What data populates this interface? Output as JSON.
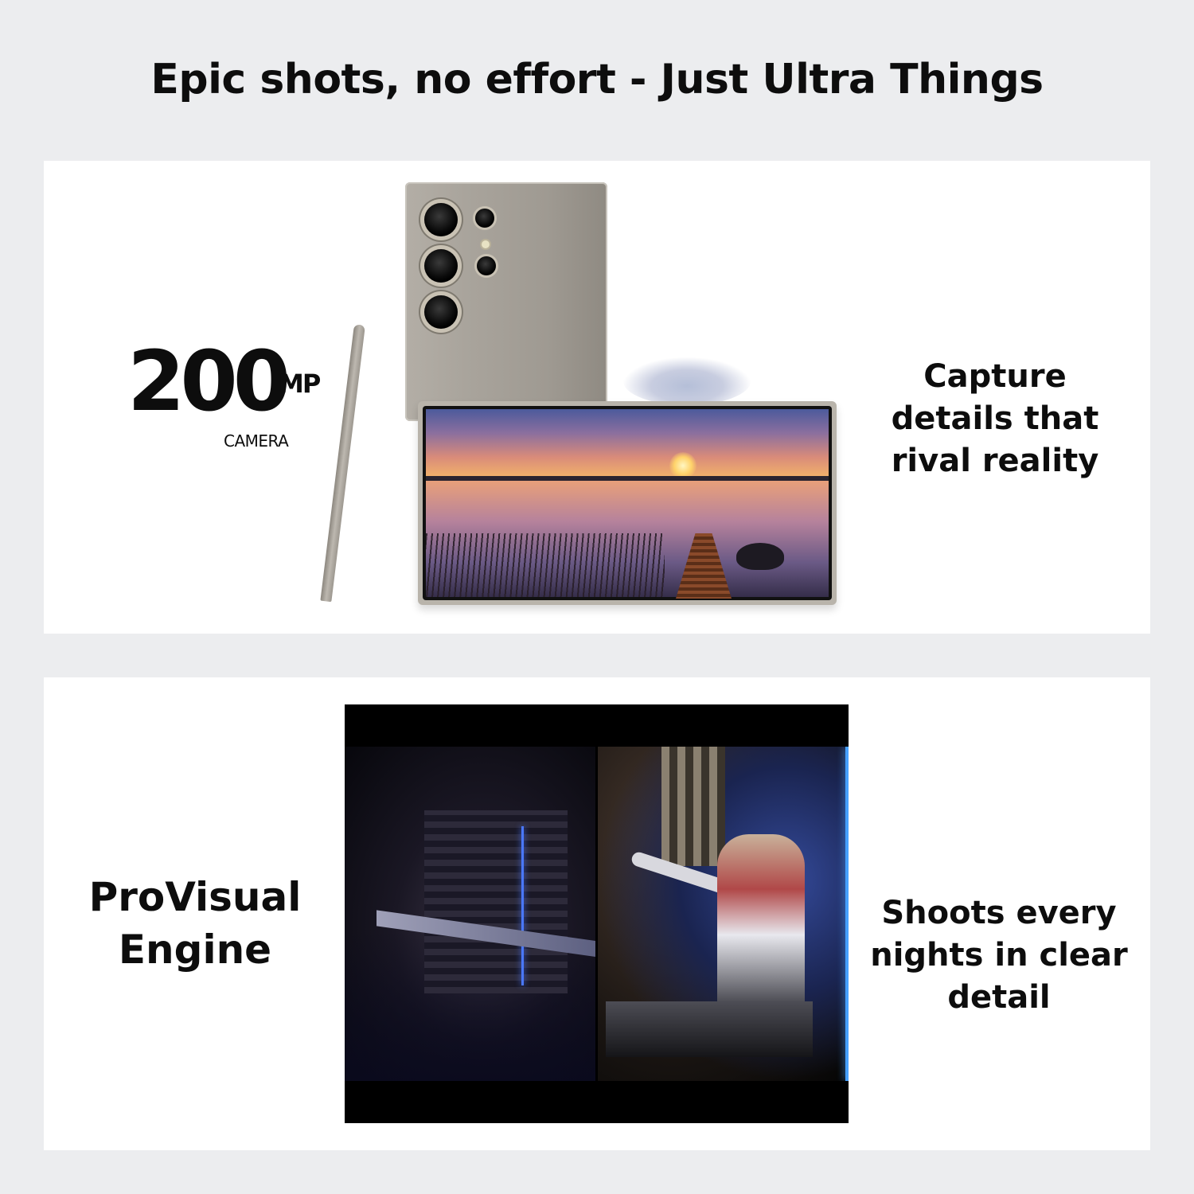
{
  "headline": "Epic shots, no effort - Just Ultra Things",
  "top_panel": {
    "badge_number": "200",
    "badge_unit": "MP",
    "badge_caption": "CAMERA",
    "side_text": "Capture details that rival reality"
  },
  "bottom_panel": {
    "left_text": "ProVisual Engine",
    "right_text": "Shoots every nights in clear detail"
  }
}
